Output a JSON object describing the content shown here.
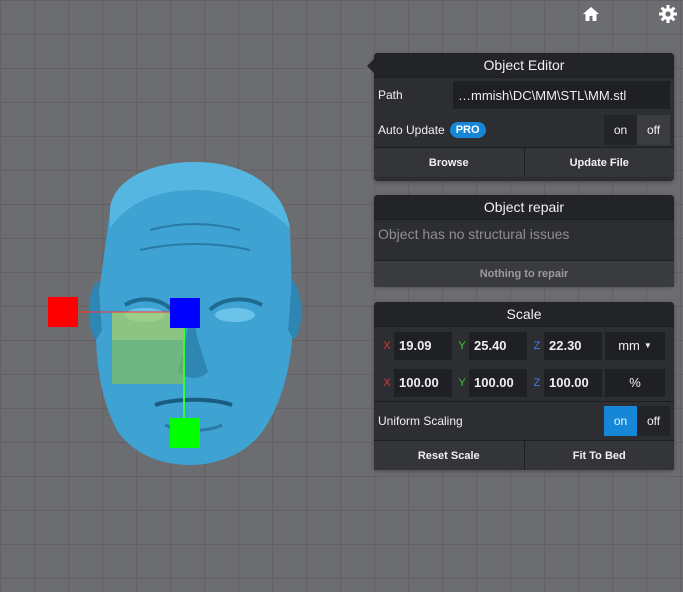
{
  "top_icons": {
    "home": "home-icon",
    "settings": "gear-icon"
  },
  "object_editor": {
    "title": "Object Editor",
    "path_label": "Path",
    "path_value": "…mmish\\DC\\MM\\STL\\MM.stl",
    "auto_update_label": "Auto Update",
    "pro_badge": "PRO",
    "toggle_on": "on",
    "toggle_off": "off",
    "browse_label": "Browse",
    "update_file_label": "Update File"
  },
  "object_repair": {
    "title": "Object repair",
    "status": "Object has no structural issues",
    "button_label": "Nothing to repair"
  },
  "scale": {
    "title": "Scale",
    "axis_x": "X",
    "axis_y": "Y",
    "axis_z": "Z",
    "size": {
      "x": "19.09",
      "y": "25.40",
      "z": "22.30",
      "unit": "mm"
    },
    "percent": {
      "x": "100.00",
      "y": "100.00",
      "z": "100.00",
      "unit": "%"
    },
    "uniform_label": "Uniform Scaling",
    "toggle_on": "on",
    "toggle_off": "off",
    "reset_label": "Reset Scale",
    "fit_label": "Fit To Bed"
  },
  "colors": {
    "accent": "#1687d6",
    "panel": "#2d2e31",
    "model": "#3ea2d2",
    "gizmo_x": "#ff0000",
    "gizmo_y": "#00ff00",
    "gizmo_z": "#0000ff"
  }
}
